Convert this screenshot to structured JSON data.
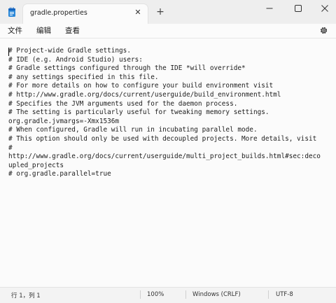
{
  "tab": {
    "title": "gradle.properties"
  },
  "menu": {
    "file": "文件",
    "edit": "编辑",
    "view": "查看"
  },
  "document": {
    "lines": [
      "# Project-wide Gradle settings.",
      "# IDE (e.g. Android Studio) users:",
      "# Gradle settings configured through the IDE *will override*",
      "# any settings specified in this file.",
      "# For more details on how to configure your build environment visit",
      "# http://www.gradle.org/docs/current/userguide/build_environment.html",
      "# Specifies the JVM arguments used for the daemon process.",
      "# The setting is particularly useful for tweaking memory settings.",
      "org.gradle.jvmargs=-Xmx1536m",
      "# When configured, Gradle will run in incubating parallel mode.",
      "# This option should only be used with decoupled projects. More details, visit",
      "#",
      "http://www.gradle.org/docs/current/userguide/multi_project_builds.html#sec:deco",
      "upled_projects",
      "# org.gradle.parallel=true"
    ]
  },
  "status": {
    "position": "行 1，列 1",
    "zoom": "100%",
    "line_ending": "Windows (CRLF)",
    "encoding": "UTF-8"
  },
  "icons": {
    "app": "notepad-icon",
    "close_tab": "close-icon",
    "new_tab": "plus-icon",
    "minimize": "minimize-icon",
    "maximize": "maximize-icon",
    "close_window": "close-icon",
    "settings": "gear-icon"
  }
}
